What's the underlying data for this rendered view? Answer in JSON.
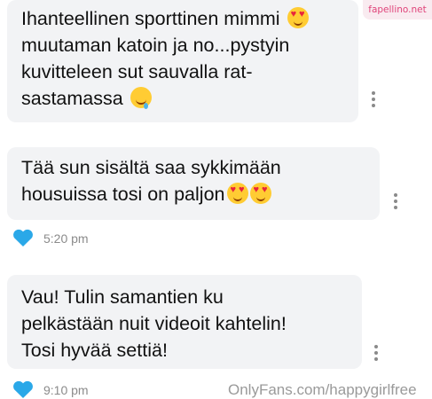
{
  "messages": [
    {
      "lines": [
        "Ihanteellinen sporttinen mimmi",
        "muutaman katoin ja no...pystyin",
        "kuvitteleen sut sauvalla rat-",
        "sastamassa"
      ],
      "line_emojis": [
        "heart-eyes-emoji",
        null,
        null,
        "drooling-face-emoji"
      ],
      "time": ""
    },
    {
      "lines": [
        "Tää sun sisältä saa sykkimään",
        "housuissa tosi on paljon"
      ],
      "line_emojis": [
        null,
        "heart-eyes-emoji x2"
      ],
      "time": "5:20 pm",
      "liked": true
    },
    {
      "lines": [
        "Vau! Tulin samantien ku",
        "pelkästään nuit videoit kahtelin!",
        "Tosi hyvää settiä!"
      ],
      "time": "9:10 pm",
      "liked": true
    }
  ],
  "watermarks": {
    "site": "fapellino.net",
    "onlyfans": "OnlyFans.com/happygirlfree"
  },
  "colors": {
    "bubble_bg": "#f2f3f5",
    "heart_blue": "#2aa8e8",
    "timestamp": "#8b8b8b"
  },
  "icons": [
    "heart-icon",
    "more-options-icon"
  ]
}
